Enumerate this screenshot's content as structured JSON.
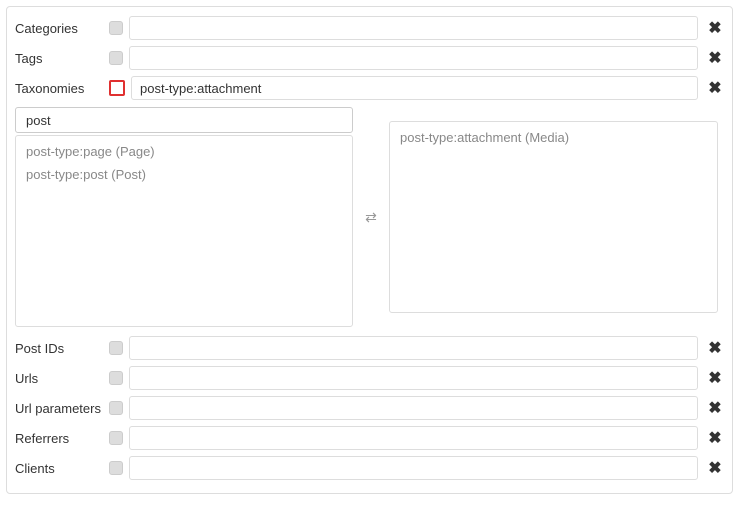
{
  "rows": {
    "categories": {
      "label": "Categories",
      "value": ""
    },
    "tags": {
      "label": "Tags",
      "value": ""
    },
    "taxonomies": {
      "label": "Taxonomies",
      "value": "post-type:attachment"
    },
    "post_ids": {
      "label": "Post IDs",
      "value": ""
    },
    "urls": {
      "label": "Urls",
      "value": ""
    },
    "url_parameters": {
      "label": "Url parameters",
      "value": ""
    },
    "referrers": {
      "label": "Referrers",
      "value": ""
    },
    "clients": {
      "label": "Clients",
      "value": ""
    }
  },
  "taxonomy_picker": {
    "search_value": "post",
    "available": [
      "post-type:page (Page)",
      "post-type:post (Post)"
    ],
    "selected": [
      "post-type:attachment (Media)"
    ]
  }
}
